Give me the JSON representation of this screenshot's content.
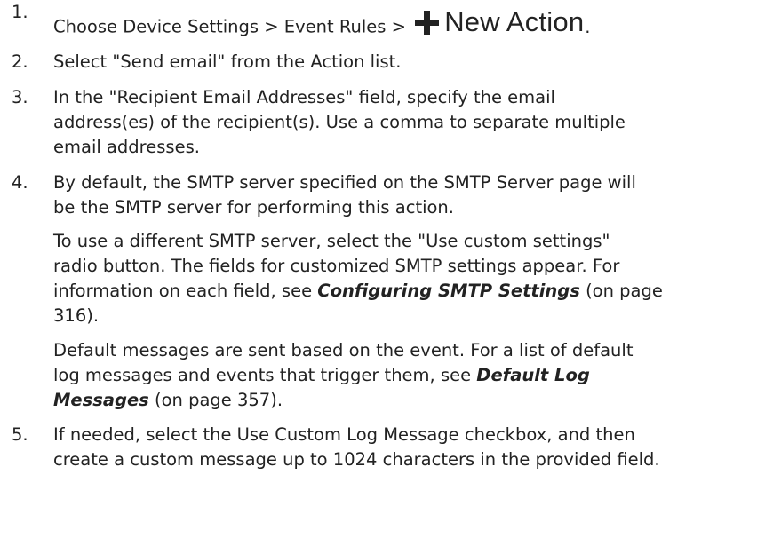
{
  "steps": [
    {
      "number": "1.",
      "text_before": "Choose Device Settings > Event Rules > ",
      "button": {
        "label": "New Action",
        "icon": "plus-icon"
      },
      "text_after": "."
    },
    {
      "number": "2.",
      "text": "Select \"Send email\" from the Action list."
    },
    {
      "number": "3.",
      "lines": [
        "In the \"Recipient Email Addresses\" field, specify the email",
        "address(es) of the recipient(s). Use a comma to separate multiple",
        "email addresses."
      ]
    },
    {
      "number": "4.",
      "lines": [
        "By default, the SMTP server specified on the SMTP Server page will",
        "be the SMTP server for performing this action."
      ],
      "para2": {
        "lines": [
          "To use a different SMTP server, select the \"Use custom settings\"",
          "radio button. The fields for customized SMTP settings appear. For"
        ],
        "line3_before": "information on each field, see ",
        "link": "Configuring SMTP Settings",
        "line3_after": " (on page",
        "line4": "316)."
      },
      "para3": {
        "line1": "Default messages are sent based on the event. For a list of default",
        "line2_before": "log messages and events that trigger them, see ",
        "link_part1": "Default Log",
        "link_part2": "Messages",
        "line3_after": " (on page 357)."
      }
    },
    {
      "number": "5.",
      "lines": [
        "If needed, select the Use Custom Log Message checkbox, and then",
        "create a custom message up to 1024 characters in the provided field."
      ]
    }
  ]
}
